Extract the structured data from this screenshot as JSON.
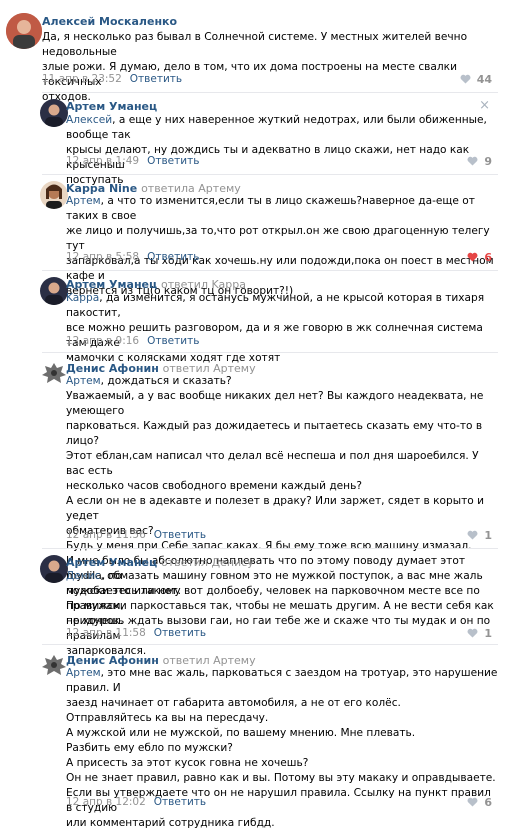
{
  "comments": [
    {
      "author": "Алексей Москаленко",
      "reply_to": "",
      "text": "Да, я несколько раз бывал в Солнечной системе. У местных жителей вечно недовольные\nзлые рожи. Я думаю, дело в том, что их дома построены на месте свалки токсичных\nотходов.",
      "mention": "",
      "date": "11 апр в 23:52",
      "action": "Ответить",
      "likes": "44",
      "liked": false
    },
    {
      "author": "Артем Уманец",
      "reply_to": "",
      "mention": "Алексей",
      "text": ", а еще у них наверенное жуткий недотрах, или были обиженные, вообще так\nкрысы делают, ну дождись ты и адекватно в лицо скажи, нет надо как крысеныш\nпоступать",
      "date": "12 апр в 1:49",
      "action": "Ответить",
      "likes": "9",
      "liked": false,
      "close": "×"
    },
    {
      "author": "Kappa Nine",
      "reply_to": "ответила Артему",
      "mention": "Артем",
      "text": ", а что то изменится,если ты в лицо скажешь?наверное да-еще от таких в свое\nже лицо и получишь,за то,что рот открыл.он же свою драгоценную телегу тут\nзапарковал,а ты ходи как хочешь.ну или подожди,пока он поест в местном кафе и\nвернется из тц(о каком тц он говорит?!)",
      "date": "12 апр в 5:58",
      "action": "Ответить",
      "likes": "6",
      "liked": true
    },
    {
      "author": "Артем Уманец",
      "reply_to": "ответил Kappa",
      "mention": "Kappa",
      "text": ", да изменится, я останусь мужчиной, а не крысой которая в тихаря пакостит,\nвсе можно решить разговором, да и я же говорю в жк солнечная система там даже\nмамочки с колясками ходят где хотят",
      "date": "12 апр в 9:16",
      "action": "Ответить",
      "likes": "",
      "liked": false
    },
    {
      "author": "Денис Афонин",
      "reply_to": "ответил Артему",
      "mention": "Артем",
      "text": ", дождаться и сказать?\nУважаемый, а у вас вообще никаких дел нет? Вы каждого неадеквата, не умеющего\nпарковаться. Каждый раз дожидаетесь и пытаетесь сказать ему что-то в лицо?\nЭтот еблан,сам написал что делал всё неспеша и пол дня шароебился. У вас есть\nнесколько часов свободного времени каждый день?\nА если он не в адекавте и полезет в драку? Или заржет, сядет в корыто и уедет\nобматерив вас?\nБудь у меня при Себе запас каках. Я бы ему тоже всю машину измазал.\nИ мне было бы абсолютно наплевать что по этому поводу думает этот mydila, по\nмужски это или нет.\nПо мужски паркоставься так, чтобы не мешать другим. А не вести себя как придурок.",
      "date": "12 апр в 11:56",
      "action": "Ответить",
      "likes": "1",
      "liked": false
    },
    {
      "author": "Артем Уманец",
      "reply_to": "ответил Денису",
      "mention": "Денис",
      "text": ", обмазать машину говном это не мужкой поступок, а вас мне жаль\nподобаетесь такому вот долбоебу, человек на парковочном месте все по правилам,\nне хочешь ждать вызови гаи, но гаи тебе же и скаже что ты мудак и он по правилам\nзапарковался.",
      "date": "12 апр в 11:58",
      "action": "Ответить",
      "likes": "1",
      "liked": false
    },
    {
      "author": "Денис Афонин",
      "reply_to": "ответил Артему",
      "mention": "Артем",
      "text": ", это мне вас жаль, парковаться с заездом на тротуар, это нарушение правил. И\nзаезд начинает от габарита автомобиля, а не от его колёс.\nОтправляйтесь ка вы на пересдачу.\nА мужской или не мужской, по вашему мнению. Мне плевать.\nРазбить ему еблo по мужски?\nА присесть за этот кусок говна не хочешь?\nОн не знает правил, равно как и вы. Потому вы эту макаку и оправдываете.\nЕсли вы утверждаете что он не нарушил правила. Ссылку на пункт правил в студию\nили комментарий сотрудника гибдд.",
      "date": "12 апр в 12:02",
      "action": "Ответить",
      "likes": "6",
      "liked": false
    }
  ],
  "colors": {
    "link": "#2a5885",
    "meta": "#939393",
    "like_active": "#e64646"
  }
}
